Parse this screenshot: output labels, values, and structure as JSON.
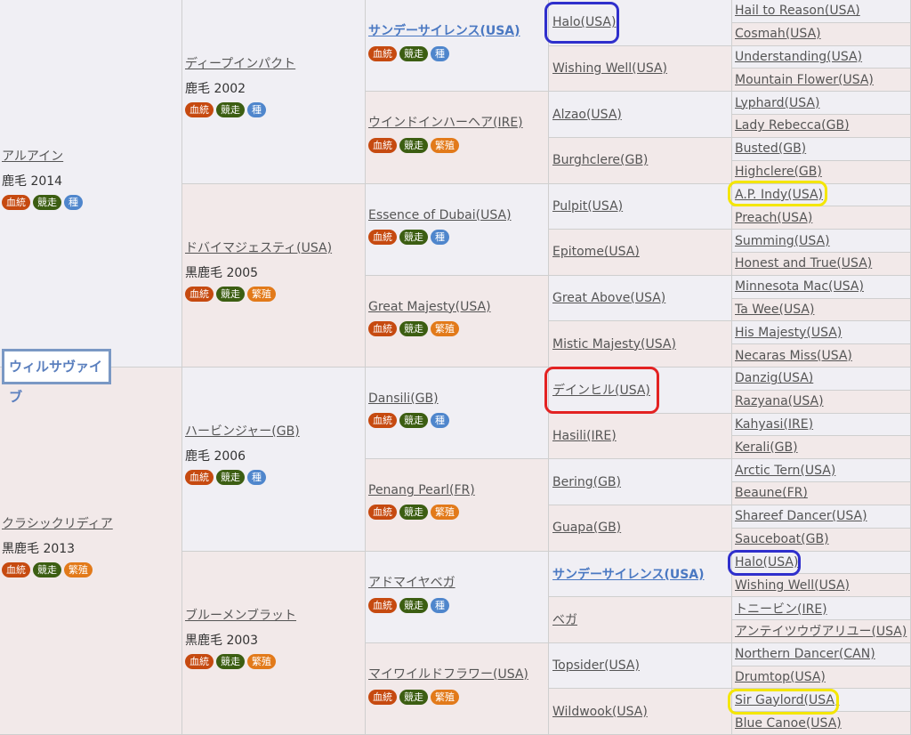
{
  "selected_horse": "ウィルサヴァイブ",
  "badge_labels": {
    "blood": "血統",
    "race": "競走",
    "sire": "種",
    "breed": "繁殖"
  },
  "gen1": [
    {
      "name": "アルアイン",
      "info": "鹿毛 2014",
      "badges": [
        "blood",
        "race",
        "sire"
      ]
    },
    {
      "name": "クラシックリディア",
      "info": "黒鹿毛 2013",
      "badges": [
        "blood",
        "race",
        "breed"
      ]
    }
  ],
  "gen2": [
    {
      "name": "ディープインパクト",
      "info": "鹿毛 2002",
      "badges": [
        "blood",
        "race",
        "sire"
      ]
    },
    {
      "name": "ドバイマジェスティ(USA)",
      "info": "黒鹿毛 2005",
      "badges": [
        "blood",
        "race",
        "breed"
      ]
    },
    {
      "name": "ハービンジャー(GB)",
      "info": "鹿毛 2006",
      "badges": [
        "blood",
        "race",
        "sire"
      ]
    },
    {
      "name": "ブルーメンブラット",
      "info": "黒鹿毛 2003",
      "badges": [
        "blood",
        "race",
        "breed"
      ]
    }
  ],
  "gen3": [
    {
      "name": "サンデーサイレンス(USA)",
      "bold": true,
      "badges": [
        "blood",
        "race",
        "sire"
      ]
    },
    {
      "name": "ウインドインハーヘア(IRE)",
      "badges": [
        "blood",
        "race",
        "breed"
      ]
    },
    {
      "name": "Essence of Dubai(USA)",
      "badges": [
        "blood",
        "race",
        "sire"
      ]
    },
    {
      "name": "Great Majesty(USA)",
      "badges": [
        "blood",
        "race",
        "breed"
      ]
    },
    {
      "name": "Dansili(GB)",
      "badges": [
        "blood",
        "race",
        "sire"
      ]
    },
    {
      "name": "Penang Pearl(FR)",
      "badges": [
        "blood",
        "race",
        "breed"
      ]
    },
    {
      "name": "アドマイヤベガ",
      "badges": [
        "blood",
        "race",
        "sire"
      ]
    },
    {
      "name": "マイワイルドフラワー(USA)",
      "badges": [
        "blood",
        "race",
        "breed"
      ]
    }
  ],
  "gen4": [
    {
      "name": "Halo(USA)"
    },
    {
      "name": "Wishing Well(USA)"
    },
    {
      "name": "Alzao(USA)"
    },
    {
      "name": "Burghclere(GB)"
    },
    {
      "name": "Pulpit(USA)"
    },
    {
      "name": "Epitome(USA)"
    },
    {
      "name": "Great Above(USA)"
    },
    {
      "name": "Mistic Majesty(USA)"
    },
    {
      "name": "デインヒル(USA)"
    },
    {
      "name": "Hasili(IRE)"
    },
    {
      "name": "Bering(GB)"
    },
    {
      "name": "Guapa(GB)"
    },
    {
      "name": "サンデーサイレンス(USA)",
      "bold": true
    },
    {
      "name": "ベガ"
    },
    {
      "name": "Topsider(USA)"
    },
    {
      "name": "Wildwook(USA)"
    }
  ],
  "gen5": [
    "Hail to Reason(USA)",
    "Cosmah(USA)",
    "Understanding(USA)",
    "Mountain Flower(USA)",
    "Lyphard(USA)",
    "Lady Rebecca(GB)",
    "Busted(GB)",
    "Highclere(GB)",
    "A.P. Indy(USA)",
    "Preach(USA)",
    "Summing(USA)",
    "Honest and True(USA)",
    "Minnesota Mac(USA)",
    "Ta Wee(USA)",
    "His Majesty(USA)",
    "Necaras Miss(USA)",
    "Danzig(USA)",
    "Razyana(USA)",
    "Kahyasi(IRE)",
    "Kerali(GB)",
    "Arctic Tern(USA)",
    "Beaune(FR)",
    "Shareef Dancer(USA)",
    "Sauceboat(GB)",
    "Halo(USA)",
    "Wishing Well(USA)",
    "トニービン(IRE)",
    "アンテイツウヴアリユー(USA)",
    "Northern Dancer(CAN)",
    "Drumtop(USA)",
    "Sir Gaylord(USA)",
    "Blue Canoe(USA)"
  ],
  "highlight_colors": {
    "blue": "#2f2fcc",
    "yellow": "#f4e600",
    "red": "#e32222"
  }
}
